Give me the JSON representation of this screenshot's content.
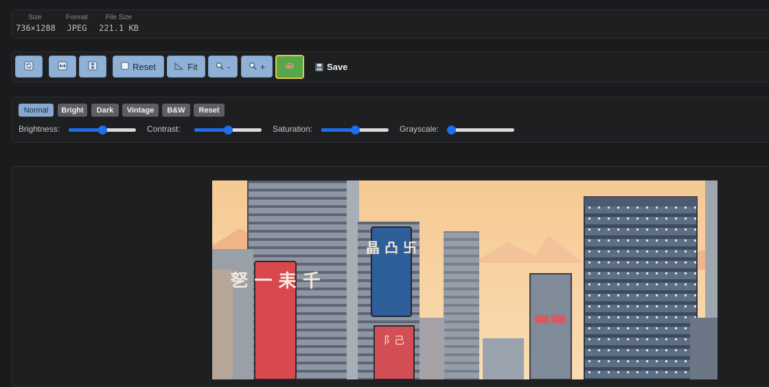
{
  "info": {
    "size_label": "Size",
    "size_value": "736×1288",
    "format_label": "Format",
    "format_value": "JPEG",
    "filesize_label": "File Size",
    "filesize_value": "221.1 KB"
  },
  "toolbar": {
    "reset_label": "Reset",
    "fit_label": "Fit",
    "zoom_out_label": "-",
    "zoom_in_label": "+",
    "save_label": "Save"
  },
  "filters": {
    "presets": [
      "Normal",
      "Bright",
      "Dark",
      "Vintage",
      "B&W",
      "Reset"
    ],
    "selected": "Normal",
    "sliders": [
      {
        "label": "Brightness:",
        "value": 0.5
      },
      {
        "label": "Contrast:",
        "value": 0.5
      },
      {
        "label": "Saturation:",
        "value": 0.5
      },
      {
        "label": "Grayscale:",
        "value": 0.0
      }
    ]
  },
  "image": {
    "sign_left": "㐐 一 耒 千",
    "sign_blue": "晶 凸 卐",
    "sign_small": "阝己"
  },
  "colors": {
    "accent": "#1f6ef0",
    "toolbar_button": "#8fb1d6",
    "active_button": "#56a64a",
    "active_border": "#e8c640"
  }
}
